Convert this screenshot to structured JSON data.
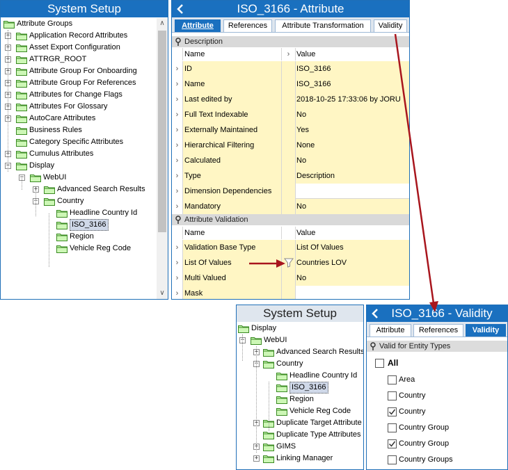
{
  "left_panel": {
    "title": "System Setup",
    "root_label": "Attribute Groups",
    "groups": [
      {
        "label": "Application Record Attributes"
      },
      {
        "label": "Asset Export Configuration"
      },
      {
        "label": "ATTRGR_ROOT"
      },
      {
        "label": "Attribute Group For Onboarding"
      },
      {
        "label": "Attribute Group For References"
      },
      {
        "label": "Attributes for Change Flags"
      },
      {
        "label": "Attributes For Glossary"
      },
      {
        "label": "AutoCare Attributes"
      },
      {
        "label": "Business Rules"
      },
      {
        "label": "Category Specific Attributes"
      },
      {
        "label": "Cumulus Attributes"
      },
      {
        "label": "Display"
      }
    ],
    "webui_label": "WebUI",
    "adv_search_label": "Advanced Search Results",
    "country_label": "Country",
    "country_children": [
      {
        "label": "Headline Country Id"
      },
      {
        "label": "ISO_3166"
      },
      {
        "label": "Region"
      },
      {
        "label": "Vehicle Reg Code"
      }
    ]
  },
  "middle_panel": {
    "title": "ISO_3166 - Attribute",
    "tabs": [
      {
        "label": "Attribute"
      },
      {
        "label": "References"
      },
      {
        "label": "Attribute Transformation"
      },
      {
        "label": "Validity"
      }
    ],
    "description_section": "Description",
    "col_name": "Name",
    "col_value": "Value",
    "rows": [
      {
        "name": "ID",
        "value": "ISO_3166"
      },
      {
        "name": "Name",
        "value": "ISO_3166"
      },
      {
        "name": "Last edited by",
        "value": "2018-10-25 17:33:06 by JORU"
      },
      {
        "name": "Full Text Indexable",
        "value": "No"
      },
      {
        "name": "Externally Maintained",
        "value": "Yes"
      },
      {
        "name": "Hierarchical Filtering",
        "value": "None"
      },
      {
        "name": "Calculated",
        "value": "No"
      },
      {
        "name": "Type",
        "value": "Description"
      },
      {
        "name": "Dimension Dependencies",
        "value": ""
      },
      {
        "name": "Mandatory",
        "value": "No"
      }
    ],
    "validation_section": "Attribute Validation",
    "validation_rows": [
      {
        "name": "Validation Base Type",
        "value": "List Of Values"
      },
      {
        "name": "List Of Values",
        "value": "Countries LOV"
      },
      {
        "name": "Multi Valued",
        "value": "No"
      },
      {
        "name": "Mask",
        "value": ""
      }
    ]
  },
  "bottom_left_panel": {
    "title": "System Setup",
    "display_label": "Display",
    "webui_label": "WebUI",
    "adv_search_label": "Advanced Search Results",
    "country_label": "Country",
    "country_children": [
      {
        "label": "Headline Country Id"
      },
      {
        "label": "ISO_3166"
      },
      {
        "label": "Region"
      },
      {
        "label": "Vehicle Reg Code"
      }
    ],
    "more_groups": [
      {
        "label": "Duplicate Target Attribute"
      },
      {
        "label": "Duplicate Type Attributes"
      },
      {
        "label": "GIMS"
      },
      {
        "label": "Linking Manager"
      }
    ]
  },
  "bottom_right_panel": {
    "title": "ISO_3166 - Validity",
    "tabs": [
      {
        "label": "Attribute"
      },
      {
        "label": "References"
      },
      {
        "label": "Validity"
      }
    ],
    "section": "Valid for Entity Types",
    "all_label": "All",
    "entity_types": [
      {
        "label": "Area",
        "checked": false
      },
      {
        "label": "Country",
        "checked": false
      },
      {
        "label": "Country",
        "checked": true
      },
      {
        "label": "Country Group",
        "checked": false
      },
      {
        "label": "Country Group",
        "checked": true
      },
      {
        "label": "Country Groups",
        "checked": false
      }
    ]
  },
  "colors": {
    "title_blue": "#1a70bf",
    "cell_yellow": "#fff6c4",
    "arrow_red": "#a8151d"
  }
}
